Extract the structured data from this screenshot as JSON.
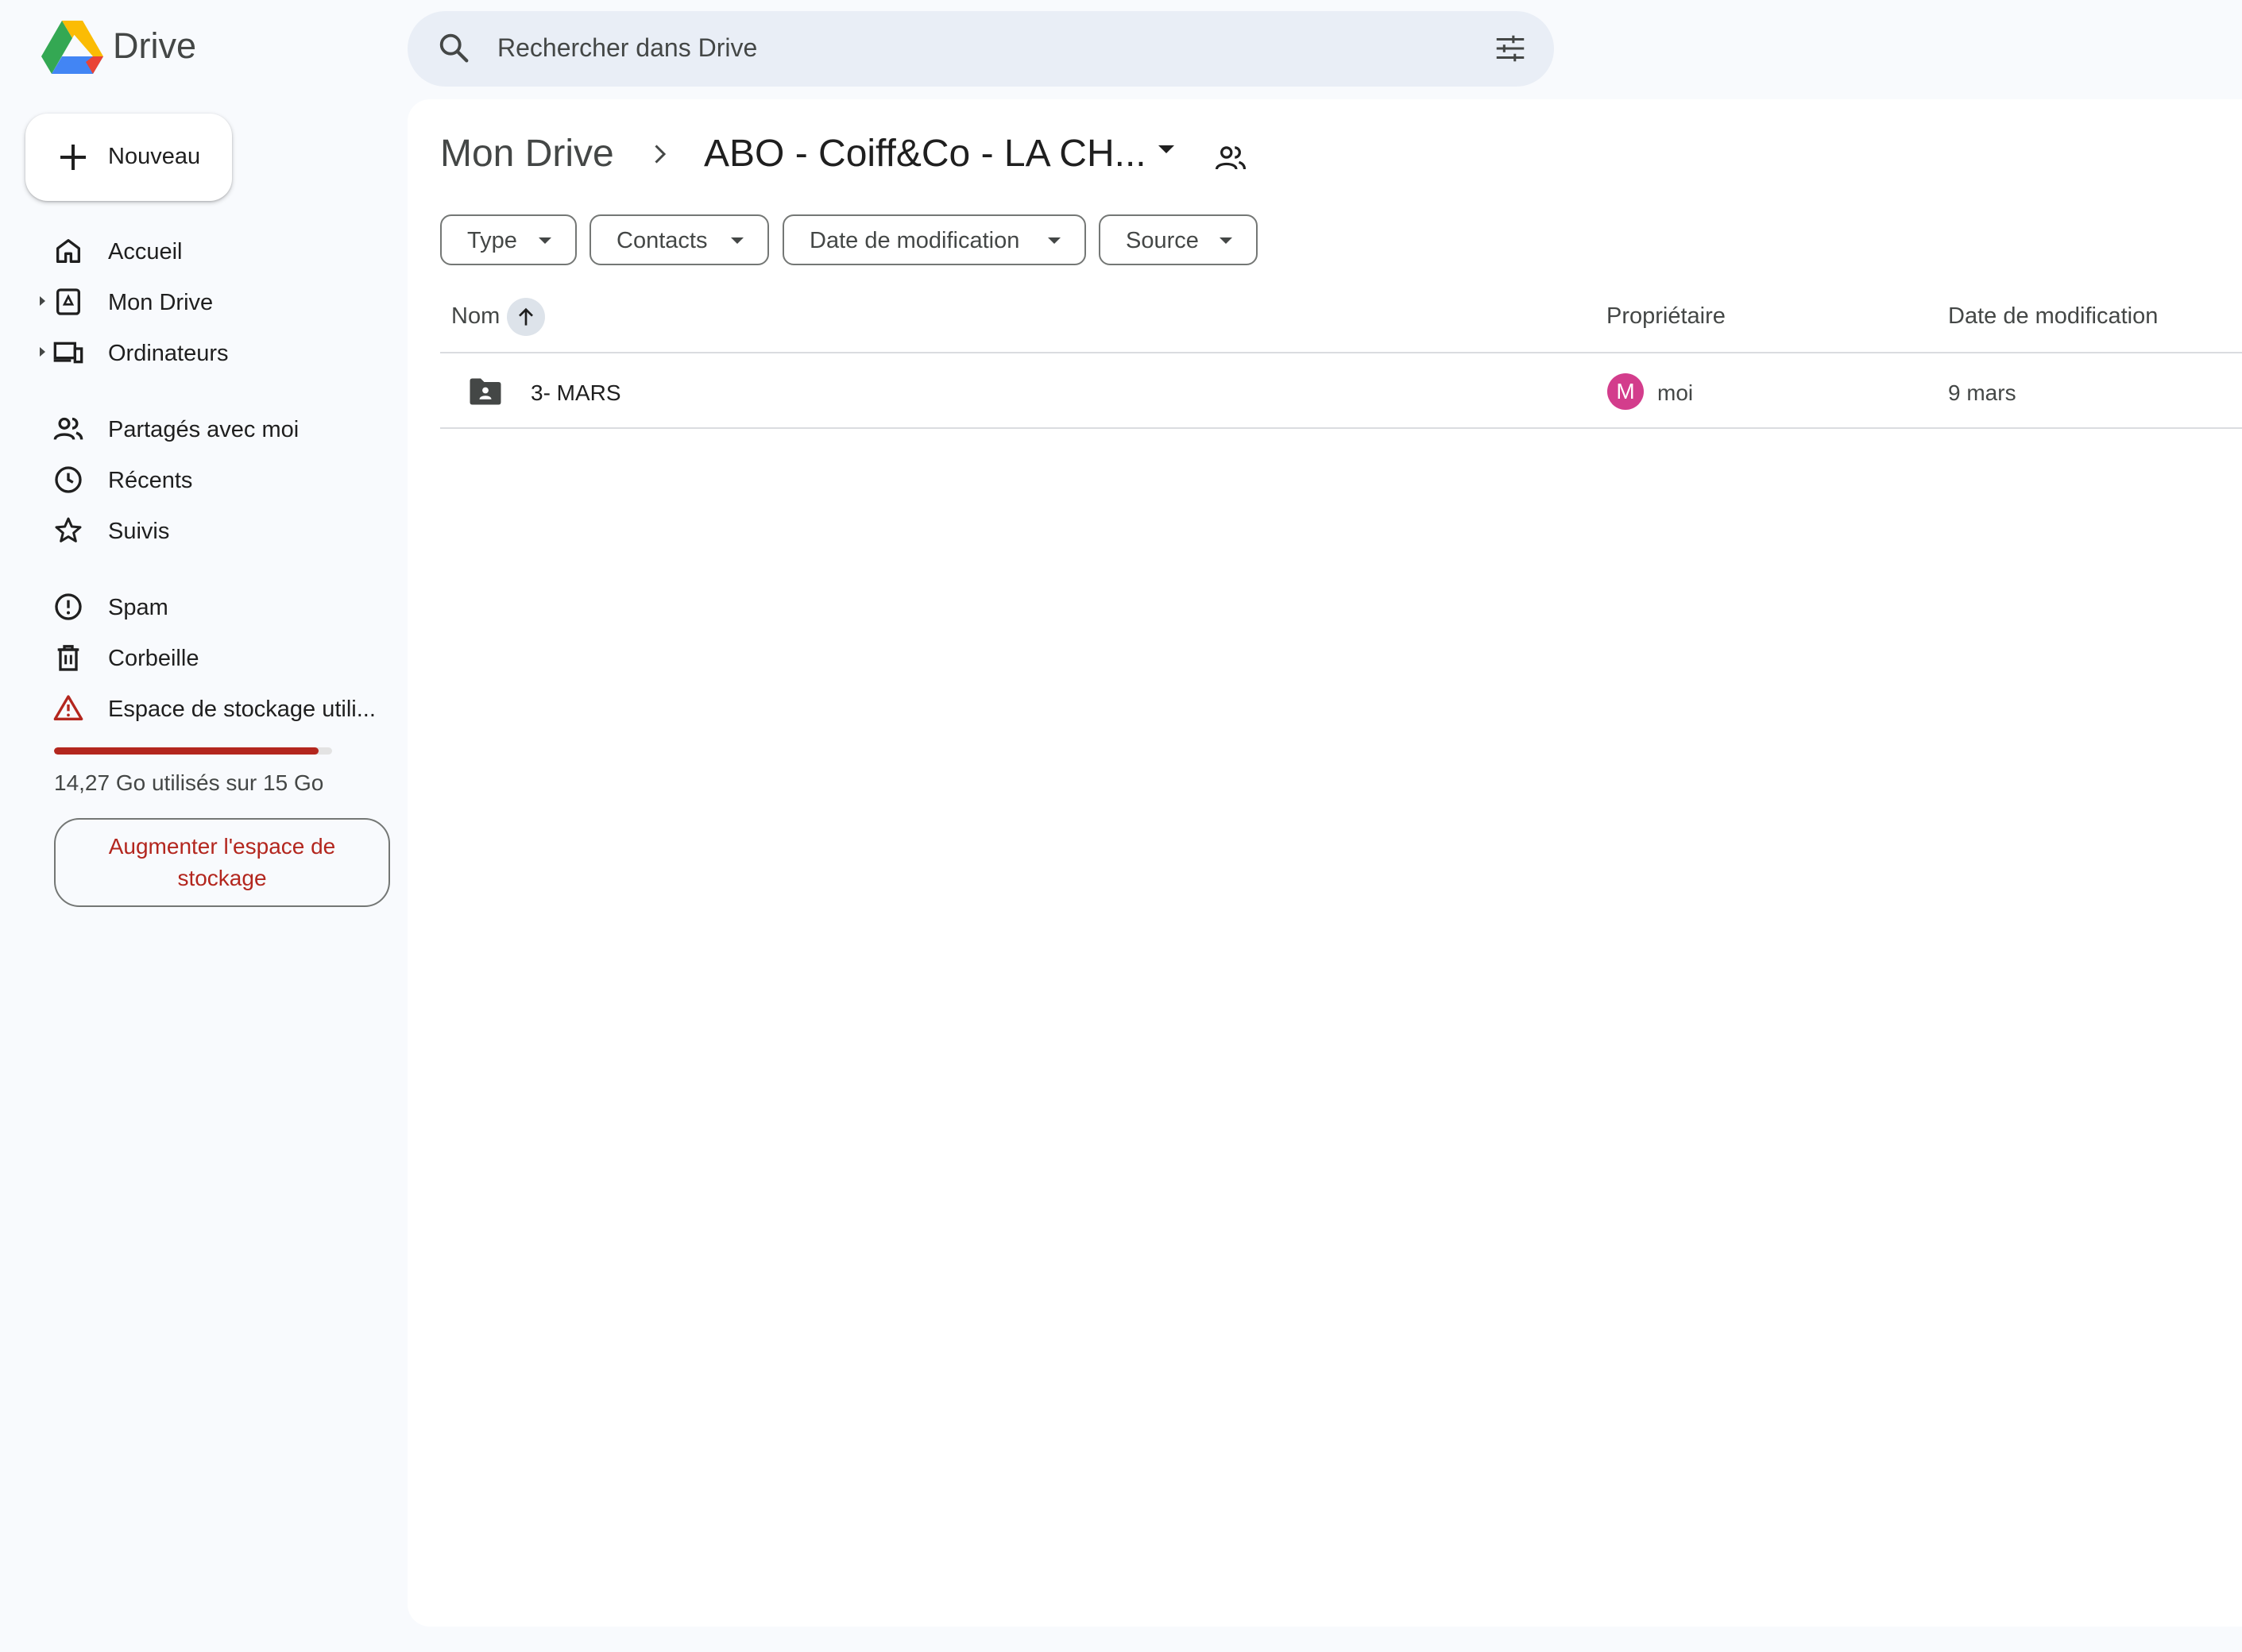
{
  "app": {
    "name": "Drive"
  },
  "search": {
    "placeholder": "Rechercher dans Drive"
  },
  "new_button": {
    "label": "Nouveau"
  },
  "sidebar": {
    "items": [
      {
        "label": "Accueil",
        "icon": "home-icon"
      },
      {
        "label": "Mon Drive",
        "icon": "my-drive-icon"
      },
      {
        "label": "Ordinateurs",
        "icon": "computers-icon"
      },
      {
        "label": "Partagés avec moi",
        "icon": "shared-icon"
      },
      {
        "label": "Récents",
        "icon": "clock-icon"
      },
      {
        "label": "Suivis",
        "icon": "star-icon"
      },
      {
        "label": "Spam",
        "icon": "spam-icon"
      },
      {
        "label": "Corbeille",
        "icon": "trash-icon"
      },
      {
        "label": "Espace de stockage utili...",
        "icon": "warning-icon"
      }
    ]
  },
  "storage": {
    "used_text": "14,27 Go utilisés sur 15 Go",
    "used_fraction": 0.951,
    "upgrade_label": "Augmenter l'espace de stockage",
    "bar_color": "#b3261e"
  },
  "breadcrumb": {
    "root": "Mon Drive",
    "current": "ABO - Coiff&Co - LA CH..."
  },
  "filters": {
    "type": "Type",
    "contacts": "Contacts",
    "date": "Date de modification",
    "source": "Source"
  },
  "table": {
    "headers": {
      "name": "Nom",
      "owner": "Propriétaire",
      "modified": "Date de modification"
    },
    "rows": [
      {
        "name": "3- MARS",
        "owner_initial": "M",
        "owner": "moi",
        "modified": "9 mars"
      }
    ]
  },
  "colors": {
    "accent": "#0b57d0",
    "danger": "#b3261e",
    "avatar": "#d33d8c"
  }
}
